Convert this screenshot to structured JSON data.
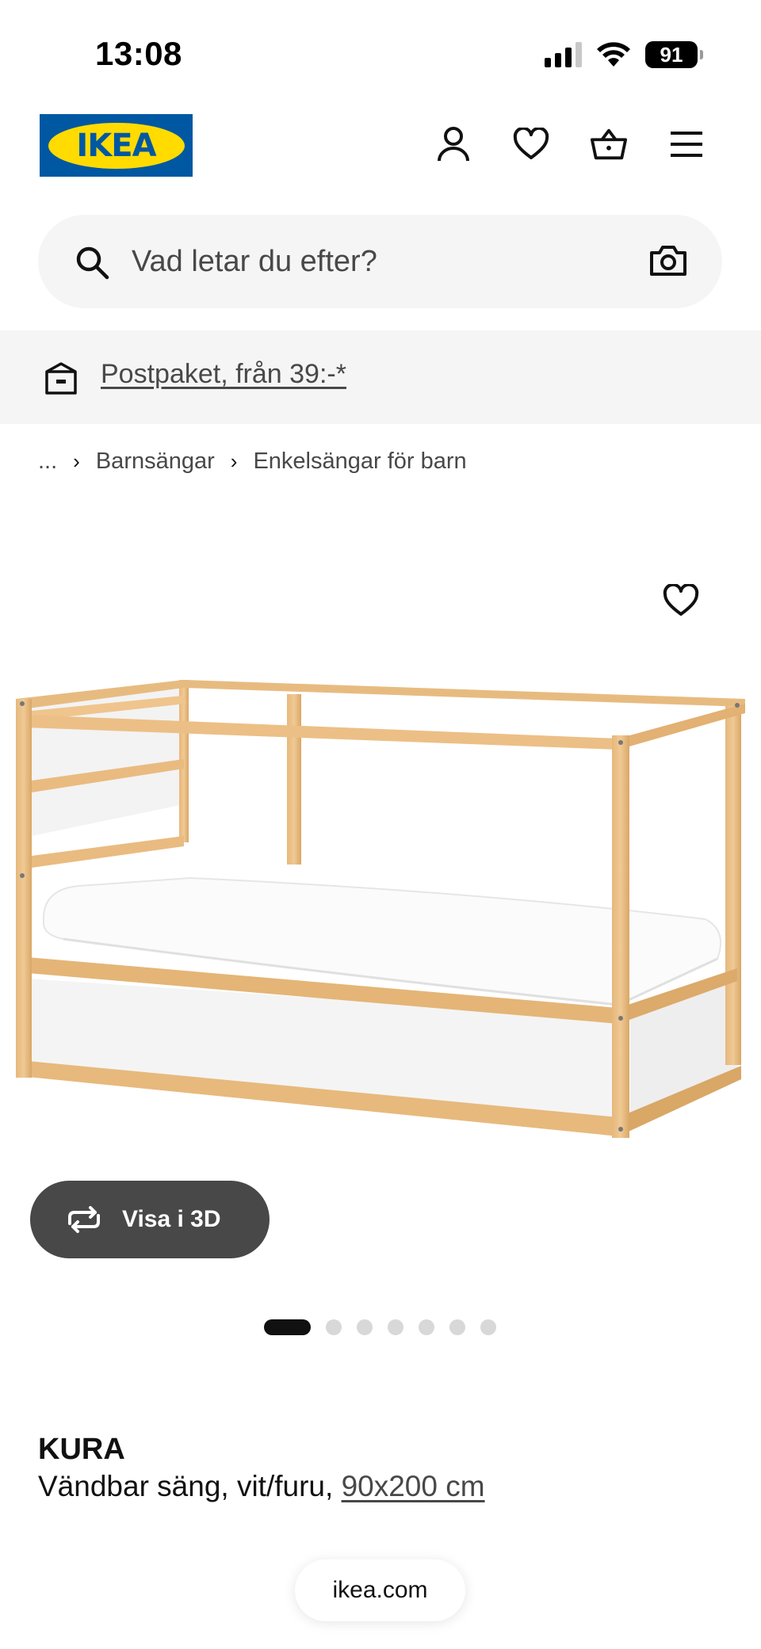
{
  "status_bar": {
    "time": "13:08",
    "battery": "91"
  },
  "header": {
    "logo_text": "IKEA",
    "icons": [
      "user-icon",
      "heart-icon",
      "basket-icon",
      "menu-icon"
    ]
  },
  "search": {
    "placeholder": "Vad letar du efter?"
  },
  "promo": {
    "link_text": "Postpaket, från 39:-*"
  },
  "breadcrumb": {
    "ellipsis": "...",
    "items": [
      "Barnsängar",
      "Enkelsängar för barn"
    ]
  },
  "gallery": {
    "view3d_label": "Visa i 3D",
    "image_count": 7,
    "active_index": 1
  },
  "product": {
    "name": "KURA",
    "description": "Vändbar säng, vit/furu, ",
    "size_link": "90x200 cm"
  },
  "browser": {
    "url": "ikea.com"
  },
  "colors": {
    "brand_blue": "#0058a3",
    "brand_yellow": "#ffdb00",
    "pill_dark": "#484848",
    "promo_bg": "#f5f5f5"
  }
}
